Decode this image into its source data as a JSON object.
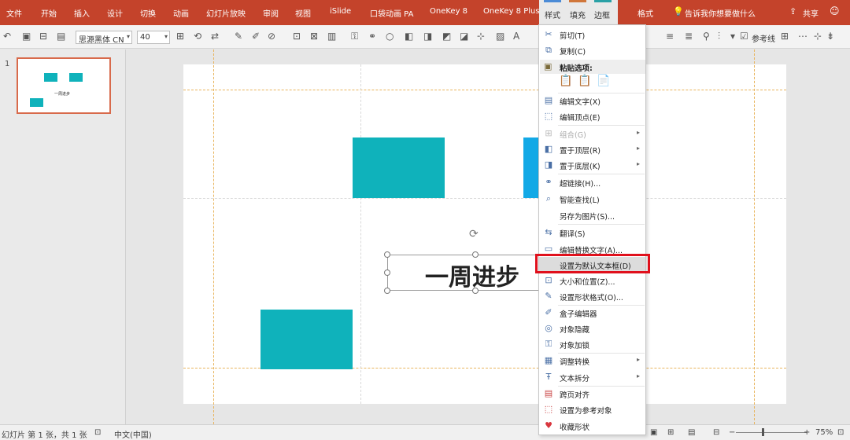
{
  "ribbon": {
    "tabs": [
      "文件",
      "开始",
      "插入",
      "设计",
      "切换",
      "动画",
      "幻灯片放映",
      "审阅",
      "视图",
      "iSlide",
      "口袋动画 PA",
      "OneKey 8",
      "OneKey 8 Plus"
    ],
    "shape_format_tabs": [
      "样式",
      "填充",
      "边框"
    ],
    "format_tab": "格式",
    "tell_me": "告诉我你想要做什么",
    "share": "共享"
  },
  "toolbar": {
    "font_name": "思源黑体 CN",
    "font_size": "40",
    "guides_label": "参考线"
  },
  "thumbnails": {
    "slide_number": "1",
    "thumb_text": "一周进步"
  },
  "slide": {
    "title": "一周进步",
    "shape_color": "#0fb2bb",
    "shape_color_2": "#13a9e6"
  },
  "status": {
    "slide_info": "幻灯片 第 1 张，共 1 张",
    "language": "中文(中国)",
    "zoom": "75%"
  },
  "context_menu": {
    "cut": "剪切(T)",
    "copy": "复制(C)",
    "paste_options": "粘贴选项:",
    "edit_text": "编辑文字(X)",
    "edit_points": "编辑顶点(E)",
    "group": "组合(G)",
    "bring_front": "置于顶层(R)",
    "send_back": "置于底层(K)",
    "hyperlink": "超链接(H)...",
    "smart_lookup": "智能查找(L)",
    "save_as_picture": "另存为图片(S)...",
    "translate": "翻译(S)",
    "edit_alt_text": "编辑替换文字(A)...",
    "set_default_textbox": "设置为默认文本框(D)",
    "size_position": "大小和位置(Z)...",
    "format_shape": "设置形状格式(O)...",
    "box_editor": "盒子编辑器",
    "hide_object": "对象隐藏",
    "lock_object": "对象加锁",
    "adjust_convert": "调整转换",
    "text_split": "文本拆分",
    "cross_page_align": "跨页对齐",
    "set_reference": "设置为参考对象",
    "favorite_shape": "收藏形状"
  }
}
